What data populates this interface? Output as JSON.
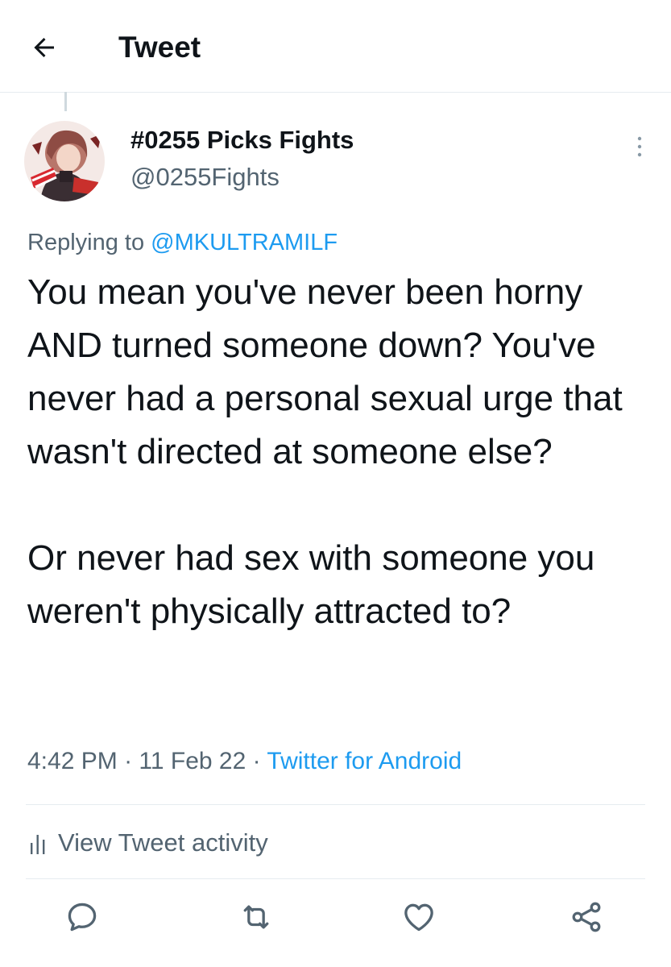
{
  "header": {
    "title": "Tweet",
    "back_icon": "arrow-left-icon"
  },
  "tweet": {
    "author": {
      "display_name": "#0255 Picks Fights",
      "handle": "@0255Fights"
    },
    "replying_prefix": "Replying to ",
    "replying_to": "@MKULTRAMILF",
    "paragraphs": [
      "You mean you've never been horny AND turned someone down? You've never had a personal sexual urge that wasn't directed at someone else?",
      "Or never had sex with someone you weren't physically attracted to?"
    ],
    "time": "4:42 PM",
    "separator": " · ",
    "date": "11 Feb 22",
    "source": "Twitter for Android"
  },
  "activity": {
    "label": "View Tweet activity",
    "icon": "bar-chart-icon"
  },
  "actions": [
    {
      "name": "reply",
      "icon": "reply-icon"
    },
    {
      "name": "retweet",
      "icon": "retweet-icon"
    },
    {
      "name": "like",
      "icon": "heart-icon"
    },
    {
      "name": "share",
      "icon": "share-icon"
    }
  ],
  "colors": {
    "accent": "#1d9bf0",
    "secondary_text": "#536471",
    "primary_text": "#0f1419",
    "divider": "#e6ecf0"
  }
}
